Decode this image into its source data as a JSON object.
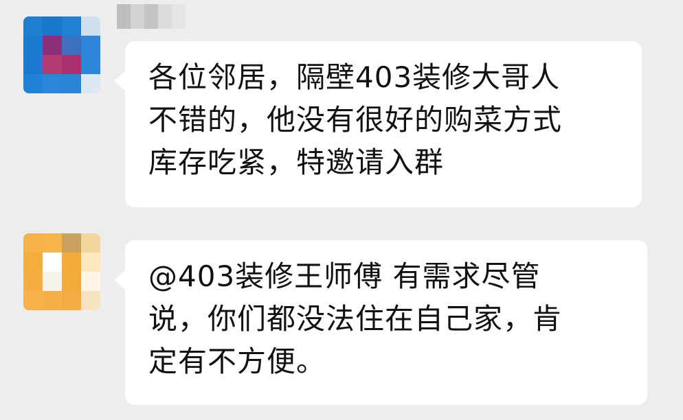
{
  "chat": {
    "messages": [
      {
        "sender_name": "",
        "avatar_colors": [
          "#1f7fd0",
          "#1a78cc",
          "#1f80d4",
          "#cfe0ef",
          "#1c7bd0",
          "#8d2f7a",
          "#3a72c0",
          "#2f86d8",
          "#1a7ad0",
          "#b23a72",
          "#a8306e",
          "#2d86d8",
          "#1f82d6",
          "#2a86d6",
          "#2a84d6",
          "#dde8f2"
        ],
        "lines": [
          "各位邻居，隔壁403装修大哥人",
          "不错的，他没有很好的购菜方式",
          "库存吃紧，特邀请入群"
        ]
      },
      {
        "avatar_colors": [
          "#f6b24a",
          "#f6b449",
          "#c9a35d",
          "#f2d59f",
          "#f5ad3c",
          "#ffffff",
          "#f4ab3b",
          "#ffe8bf",
          "#f6ad41",
          "#f7f2ea",
          "#f3aa3b",
          "#fff6e8",
          "#f7b24a",
          "#f5b04a",
          "#f4ad45",
          "#f6e2be"
        ],
        "lines": [
          "@403装修王师傅 有需求尽管",
          "说，你们都没法住在自己家，肯",
          "定有不方便。"
        ]
      }
    ]
  }
}
